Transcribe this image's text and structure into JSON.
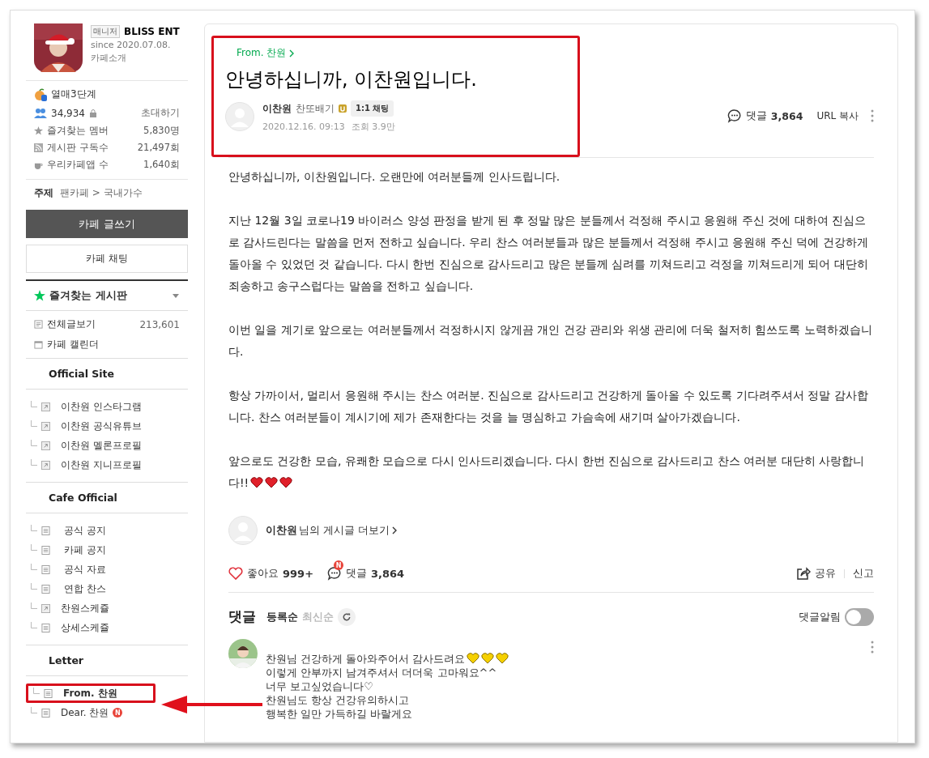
{
  "sidebar": {
    "profile": {
      "role_badge": "매니저",
      "name": "BLISS ENT",
      "since": "since 2020.07.08.",
      "intro": "카페소개"
    },
    "level": "열매3단계",
    "members": "34,934",
    "invite": "초대하기",
    "stats": [
      {
        "kind": "star",
        "label": "즐겨찾는 멤버",
        "value": "5,830명"
      },
      {
        "kind": "rss",
        "label": "게시판 구독수",
        "value": "21,497회"
      },
      {
        "kind": "cup",
        "label": "우리카페앱 수",
        "value": "1,640회"
      }
    ],
    "topic": {
      "label": "주제",
      "path": "팬카페 > 국내가수"
    },
    "write_button": "카페 글쓰기",
    "chat_button": "카페 채팅",
    "favorites": "즐겨찾는 게시판",
    "all_posts": {
      "label": "전체글보기",
      "count": "213,601"
    },
    "calendar": "카페 캘린더",
    "menu_groups": [
      {
        "title": "Official Site",
        "items": [
          {
            "label": "이찬원 인스타그램",
            "kind": "link",
            "selected": false
          },
          {
            "label": "이찬원 공식유튜브",
            "kind": "link",
            "selected": false
          },
          {
            "label": "이찬원 멜론프로필",
            "kind": "link",
            "selected": false
          },
          {
            "label": "이찬원 지니프로필",
            "kind": "link",
            "selected": false
          }
        ]
      },
      {
        "title": "Cafe Official",
        "items": [
          {
            "label": " 공식 공지",
            "kind": "board",
            "selected": false
          },
          {
            "label": " 카페 공지",
            "kind": "board",
            "selected": false
          },
          {
            "label": " 공식 자료",
            "kind": "board",
            "selected": false
          },
          {
            "label": " 연합 찬스",
            "kind": "board",
            "selected": false
          },
          {
            "label": "찬원스케쥴",
            "kind": "link",
            "selected": false
          },
          {
            "label": "상세스케쥴",
            "kind": "board",
            "selected": false
          }
        ]
      },
      {
        "title": "Letter",
        "items": [
          {
            "label": "From. 찬원",
            "kind": "board",
            "selected": true
          },
          {
            "label": "Dear. 찬원",
            "kind": "board",
            "selected": false,
            "badge": "N"
          }
        ]
      }
    ]
  },
  "article": {
    "board": "From. 찬원",
    "title": "안녕하십니까, 이찬원입니다.",
    "author": "이찬원",
    "grade": "찬또배기",
    "chat": "1:1 채팅",
    "date": "2020.12.16. 09:13",
    "views": "조회 3.9만",
    "comments_label": "댓글",
    "comments_count": "3,864",
    "url_copy": "URL 복사",
    "paragraphs": [
      "안녕하십니까, 이찬원입니다. 오랜만에 여러분들께 인사드립니다.",
      "지난 12월 3일 코로나19 바이러스 양성 판정을 받게 된 후 정말 많은 분들께서 걱정해 주시고 응원해 주신 것에 대하여 진심으로 감사드린다는 말씀을 먼저 전하고 싶습니다. 우리 찬스 여러분들과 많은 분들께서 걱정해 주시고 응원해 주신 덕에 건강하게 돌아올 수 있었던 것 같습니다. 다시 한번 진심으로 감사드리고 많은 분들께 심려를 끼쳐드리고 걱정을 끼쳐드리게 되어 대단히 죄송하고 송구스럽다는 말씀을 전하고 싶습니다.",
      "이번 일을 계기로 앞으로는 여러분들께서 걱정하시지 않게끔 개인 건강 관리와 위생 관리에 더욱 철저히 힘쓰도록 노력하겠습니다.",
      "항상 가까이서, 멀리서 응원해 주시는 찬스 여러분. 진심으로 감사드리고 건강하게 돌아올 수 있도록 기다려주셔서 정말 감사합니다. 찬스 여러분들이 계시기에 제가 존재한다는 것을 늘 명심하고 가슴속에 새기며 살아가겠습니다.",
      "앞으로도 건강한 모습, 유쾌한 모습으로 다시 인사드리겠습니다. 다시 한번 진심으로 감사드리고 찬스 여러분 대단히 사랑합니다!!"
    ],
    "more_posts": {
      "author": "이찬원",
      "suffix": "님의 게시글 더보기"
    },
    "like_label": "좋아요",
    "like_count": "999+",
    "comment_label": "댓글",
    "comment_count": "3,864",
    "comment_badge": "N",
    "share": "공유",
    "report": "신고"
  },
  "comments": {
    "title": "댓글",
    "sort": [
      {
        "label": "등록순",
        "selected": true
      },
      {
        "label": "최신순",
        "selected": false
      }
    ],
    "notify_label": "댓글알림",
    "notify_on": false,
    "items": [
      {
        "lines": [
          "찬원님 건강하게 돌아와주어서 감사드려요",
          "이렇게 안부까지 남겨주셔서 더더욱 고마워요^^",
          "너무 보고싶었습니다♡",
          "찬원님도 항상 건강유의하시고",
          "행복한 일만 가득하길 바랄게요"
        ]
      }
    ]
  }
}
